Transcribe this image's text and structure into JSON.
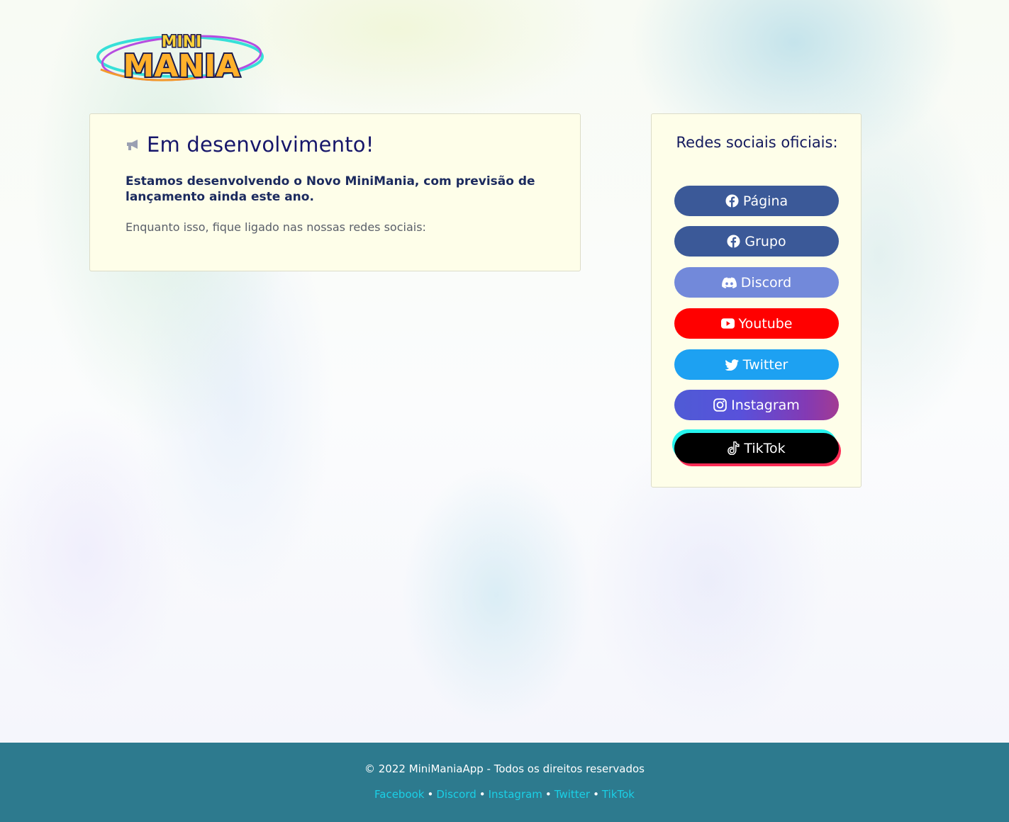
{
  "header": {
    "logo_top": "MINI",
    "logo_bottom": "MANIA"
  },
  "main": {
    "title": "Em desenvolvimento!",
    "lead": "Estamos desenvolvendo o Novo MiniMania, com previsão de lançamento ainda este ano.",
    "note": "Enquanto isso, fique ligado nas nossas redes sociais:"
  },
  "sidebar": {
    "title": "Redes sociais oficiais:",
    "buttons": [
      {
        "label": "Página",
        "icon": "facebook-icon",
        "color": "#3b5998"
      },
      {
        "label": "Grupo",
        "icon": "facebook-icon",
        "color": "#3b5998"
      },
      {
        "label": "Discord",
        "icon": "discord-icon",
        "color": "#7289da"
      },
      {
        "label": "Youtube",
        "icon": "youtube-icon",
        "color": "#ff0000"
      },
      {
        "label": "Twitter",
        "icon": "twitter-icon",
        "color": "#1da1f2"
      },
      {
        "label": "Instagram",
        "icon": "instagram-icon",
        "color": "#833ab4"
      },
      {
        "label": "TikTok",
        "icon": "tiktok-icon",
        "color": "#000000"
      }
    ]
  },
  "footer": {
    "copyright": "© 2022 MiniManiaApp - Todos os direitos reservados",
    "links": [
      "Facebook",
      "Discord",
      "Instagram",
      "Twitter",
      "TikTok"
    ],
    "separator": "•",
    "background": "#2d7a8e",
    "link_color": "#1ad0e6"
  }
}
